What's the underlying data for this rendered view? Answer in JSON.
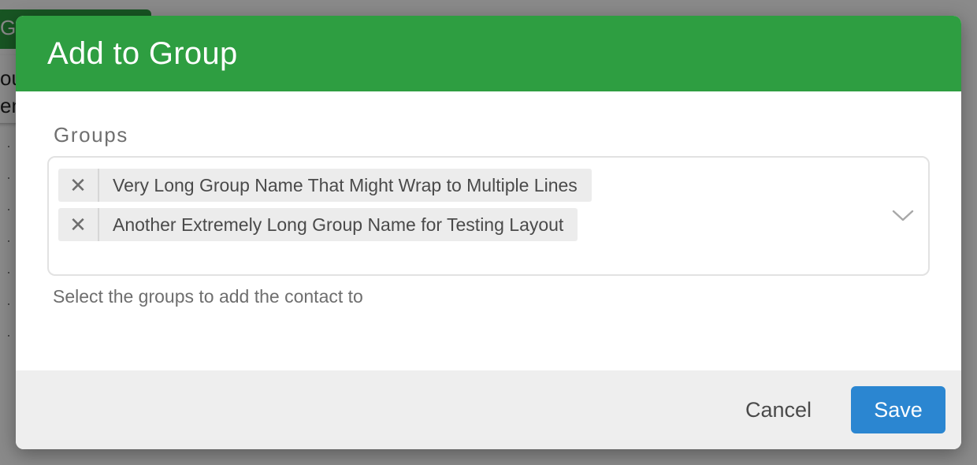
{
  "background": {
    "button_label": "Gr",
    "card_line_1": "ou",
    "card_line_2": "en"
  },
  "modal": {
    "title": "Add to Group",
    "field_label": "Groups",
    "selected_groups": [
      "Very Long Group Name That Might Wrap to Multiple Lines",
      "Another Extremely Long Group Name for Testing Layout"
    ],
    "help_text": "Select the groups to add the contact to",
    "remove_icon": "close-icon",
    "dropdown_icon": "chevron-down-icon"
  },
  "footer": {
    "cancel_label": "Cancel",
    "save_label": "Save"
  },
  "colors": {
    "header": "#2e9e41",
    "primary_button": "#2b86d1",
    "footer": "#eeeeee"
  }
}
